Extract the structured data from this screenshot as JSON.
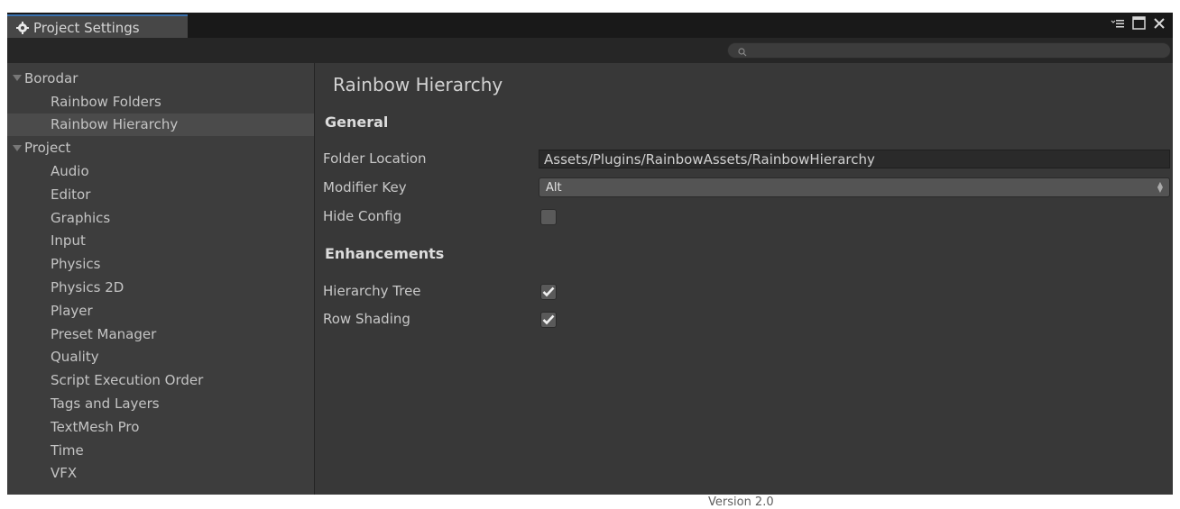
{
  "window": {
    "tab_title": "Project Settings"
  },
  "sidebar": {
    "items": [
      {
        "label": "Borodar",
        "kind": "group",
        "top": 0
      },
      {
        "label": "Rainbow Folders",
        "kind": "child"
      },
      {
        "label": "Rainbow Hierarchy",
        "kind": "child",
        "selected": true
      },
      {
        "label": "Project",
        "kind": "group"
      },
      {
        "label": "Audio",
        "kind": "child"
      },
      {
        "label": "Editor",
        "kind": "child"
      },
      {
        "label": "Graphics",
        "kind": "child"
      },
      {
        "label": "Input",
        "kind": "child"
      },
      {
        "label": "Physics",
        "kind": "child"
      },
      {
        "label": "Physics 2D",
        "kind": "child"
      },
      {
        "label": "Player",
        "kind": "child"
      },
      {
        "label": "Preset Manager",
        "kind": "child"
      },
      {
        "label": "Quality",
        "kind": "child"
      },
      {
        "label": "Script Execution Order",
        "kind": "child"
      },
      {
        "label": "Tags and Layers",
        "kind": "child"
      },
      {
        "label": "TextMesh Pro",
        "kind": "child"
      },
      {
        "label": "Time",
        "kind": "child"
      },
      {
        "label": "VFX",
        "kind": "child"
      }
    ]
  },
  "content": {
    "title": "Rainbow Hierarchy",
    "general_header": "General",
    "folder_location_label": "Folder Location",
    "folder_location_value": "Assets/Plugins/RainbowAssets/RainbowHierarchy",
    "modifier_key_label": "Modifier Key",
    "modifier_key_value": "Alt",
    "hide_config_label": "Hide Config",
    "hide_config_checked": false,
    "enhancements_header": "Enhancements",
    "hierarchy_tree_label": "Hierarchy Tree",
    "hierarchy_tree_checked": true,
    "row_shading_label": "Row Shading",
    "row_shading_checked": true,
    "version": "Version 2.0"
  },
  "colors": {
    "panel_bg": "#383838",
    "sidebar_bg": "#3d3d3d",
    "selected_bg": "#4b4b4b",
    "tab_accent": "#3a72b0"
  },
  "icons": [
    "gear-icon",
    "menu-icon",
    "maximize-icon",
    "close-icon",
    "search-icon",
    "checkmark-icon"
  ]
}
